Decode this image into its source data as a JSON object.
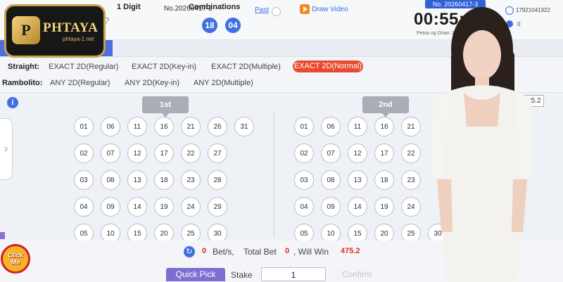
{
  "brand": {
    "logo_mark": "P",
    "name": "PHTAYA",
    "site": "phtaya-1.net",
    "fragment": "?"
  },
  "header": {
    "draw_no": "No.20260417-2",
    "result_balls": [
      "18",
      "04"
    ],
    "past_label": "Past",
    "draw_video_label": "Draw Video",
    "next_draw_no": "No. 20260417-3",
    "countdown": "00:55:26",
    "petsa_label": "Petsa ng Draw: 2026-0",
    "account_id": "17921041922",
    "balance": "0"
  },
  "nav": {
    "tabs": [
      "1 Digit",
      "Combinations"
    ]
  },
  "straight": {
    "label": "Straight:",
    "options": [
      "EXACT 2D(Regular)",
      "EXACT 2D(Key-in)",
      "EXACT 2D(Multiple)",
      "EXACT 2D(Normal)"
    ],
    "selected": "EXACT 2D(Normal)"
  },
  "rambolito": {
    "label": "Rambolito:",
    "options": [
      "ANY 2D(Regular)",
      "ANY 2D(Key-in)",
      "ANY 2D(Multiple)"
    ]
  },
  "positions": {
    "first": "1st",
    "second": "2nd"
  },
  "max_win_display": "475.2",
  "numbers_first": [
    [
      "01",
      "06",
      "11",
      "16",
      "21",
      "26",
      "31"
    ],
    [
      "02",
      "07",
      "12",
      "17",
      "22",
      "27"
    ],
    [
      "03",
      "08",
      "13",
      "18",
      "23",
      "28"
    ],
    [
      "04",
      "09",
      "14",
      "19",
      "24",
      "29"
    ],
    [
      "05",
      "10",
      "15",
      "20",
      "25",
      "30"
    ]
  ],
  "numbers_second": [
    [
      "01",
      "06",
      "11",
      "16",
      "21"
    ],
    [
      "02",
      "07",
      "12",
      "17",
      "22"
    ],
    [
      "03",
      "08",
      "13",
      "18",
      "23"
    ],
    [
      "04",
      "09",
      "14",
      "19",
      "24"
    ],
    [
      "05",
      "10",
      "15",
      "20",
      "25",
      "30"
    ]
  ],
  "summary": {
    "bets": "0",
    "bets_label": "Bet/s,",
    "total_label": "Total Bet",
    "total": "0",
    "win_label": ", Will Win",
    "win": "475.2"
  },
  "stake": {
    "quick_pick": "Quick Pick",
    "label": "Stake",
    "value": "1",
    "confirm": "Confirm"
  },
  "promo": {
    "click_me": "Click Me"
  },
  "colors": {
    "accent_blue": "#3f6fe0",
    "selected_red": "#e94a2f",
    "quick_pick_purple": "#7c6fd1",
    "logo_gold": "#c9a24a"
  }
}
